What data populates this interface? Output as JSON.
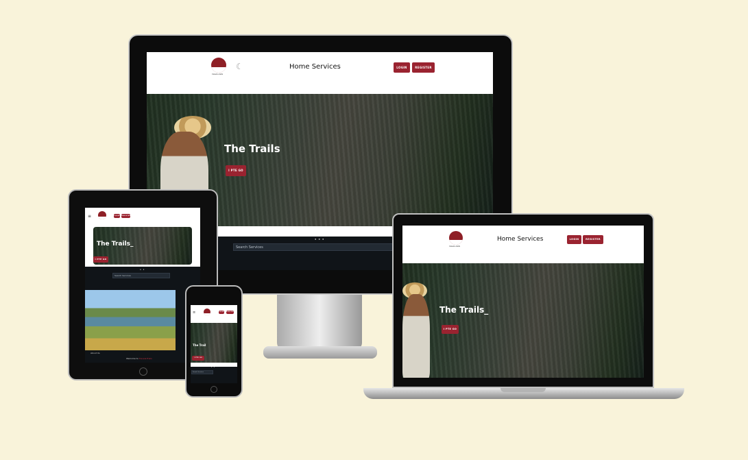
{
  "site": {
    "logo_text": "travels-trails",
    "nav_links": "Home  Services",
    "login_label": "LOGIN",
    "register_label": "REGISTER",
    "hero_title": "The Trails",
    "hero_title_typing": "The Trails_",
    "hero_title_mobile": "The Trail",
    "hero_button": "I PTE GO",
    "hero_button_small": "I PTE GO",
    "search_placeholder": "Search Services",
    "carousel_dots": "● ● ●",
    "carousel_dots_short": "● ●",
    "about_label": "About Us",
    "welcome_prefix": "Welcome to ",
    "welcome_brand": "Travels-Trails"
  },
  "colors": {
    "background": "#f9f3da",
    "brand": "#8e1f26",
    "button": "#9a2330",
    "dark": "#101418"
  },
  "icons": [
    "moon-icon",
    "menu-icon",
    "logo-icon"
  ]
}
